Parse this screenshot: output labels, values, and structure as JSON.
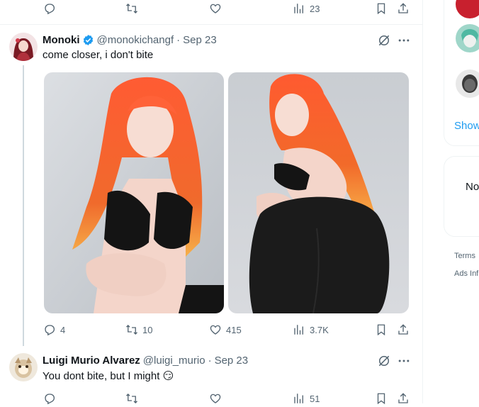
{
  "top_tweet": {
    "views": "23"
  },
  "tweet": {
    "name": "Monoki",
    "handle": "@monokichangf",
    "dot": "·",
    "date": "Sep 23",
    "text": "come closer, i don't bite",
    "replies": "4",
    "reposts": "10",
    "likes": "415",
    "views": "3.7K"
  },
  "reply": {
    "name": "Luigi Murio Alvarez",
    "handle": "@luigi_murio",
    "dot": "·",
    "date": "Sep 23",
    "text": "You dont bite, but I might",
    "emoji": "😏",
    "views": "51"
  },
  "sidebar": {
    "show_more": "Show",
    "card_text": "No",
    "terms": "Terms",
    "ads": "Ads Inf"
  },
  "colors": {
    "text_primary": "#0f1419",
    "text_secondary": "#536471",
    "accent": "#1d9bf0",
    "border": "#eff3f4"
  },
  "icons": [
    "reply-icon",
    "repost-icon",
    "like-icon",
    "views-icon",
    "bookmark-icon",
    "share-icon",
    "verified-badge-icon",
    "grok-icon",
    "more-icon"
  ]
}
